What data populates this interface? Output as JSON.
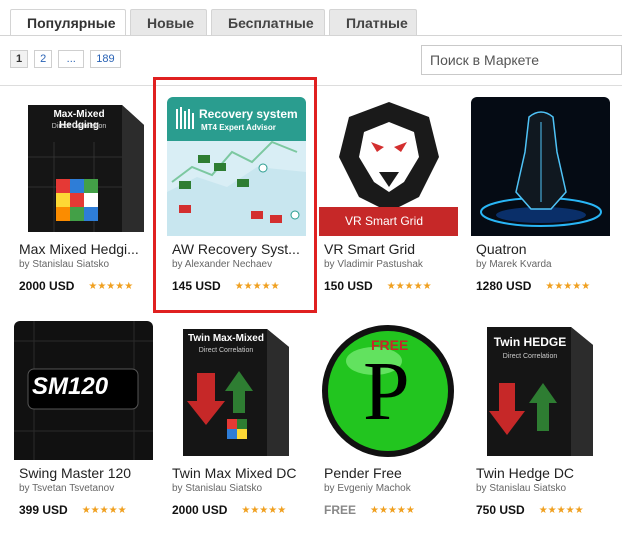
{
  "tabs": [
    {
      "label": "Популярные",
      "active": true
    },
    {
      "label": "Новые",
      "active": false
    },
    {
      "label": "Бесплатные",
      "active": false
    },
    {
      "label": "Платные",
      "active": false
    }
  ],
  "pager": [
    "1",
    "2",
    "...",
    "189"
  ],
  "search": {
    "placeholder": "Поиск в Маркете"
  },
  "products": [
    {
      "title": "Max Mixed Hedgi...",
      "author": "by Stanislau Siatsko",
      "price": "2000 USD",
      "art_text": "Max-Mixed Hedging",
      "art_sub": "Direct Correlation"
    },
    {
      "title": "AW Recovery Syst...",
      "author": "by Alexander Nechaev",
      "price": "145 USD",
      "art_text": "Recovery system",
      "art_sub": "MT4 Expert Advisor"
    },
    {
      "title": "VR Smart Grid",
      "author": "by Vladimir Pastushak",
      "price": "150 USD",
      "art_text": "VR Smart Grid"
    },
    {
      "title": "Quatron",
      "author": "by Marek Kvarda",
      "price": "1280 USD"
    },
    {
      "title": "Swing Master 120",
      "author": "by Tsvetan Tsvetanov",
      "price": "399 USD",
      "art_text": "SM120"
    },
    {
      "title": "Twin Max Mixed DC",
      "author": "by Stanislau Siatsko",
      "price": "2000 USD",
      "art_text": "Twin Max-Mixed",
      "art_sub": "Direct Correlation"
    },
    {
      "title": "Pender Free",
      "author": "by Evgeniy Machok",
      "price": "FREE",
      "art_text": "FREE",
      "art_letter": "P"
    },
    {
      "title": "Twin Hedge DC",
      "author": "by Stanislau Siatsko",
      "price": "750 USD",
      "art_text": "Twin HEDGE",
      "art_sub": "Direct Correlation"
    }
  ],
  "stars_glyph": "★★★★★",
  "colors": {
    "highlight": "#e02020",
    "link": "#2a63b5",
    "star": "#f0a020"
  }
}
